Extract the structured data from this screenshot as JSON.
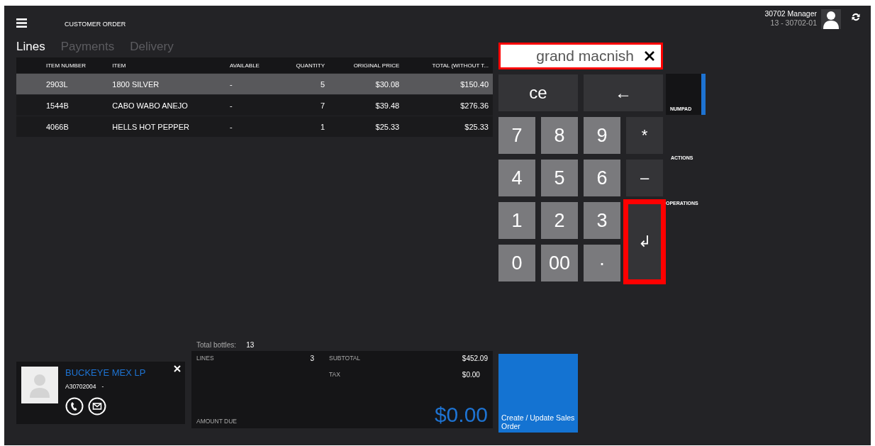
{
  "header": {
    "title": "CUSTOMER ORDER",
    "user_name": "30702 Manager",
    "user_terminal": "13 - 30702-01"
  },
  "tabs": [
    {
      "label": "Lines",
      "selected": true
    },
    {
      "label": "Payments",
      "selected": false
    },
    {
      "label": "Delivery",
      "selected": false
    }
  ],
  "table": {
    "columns": [
      "ITEM NUMBER",
      "ITEM",
      "AVAILABLE",
      "QUANTITY",
      "ORIGINAL PRICE",
      "TOTAL (WITHOUT T..."
    ],
    "rows": [
      {
        "cells": [
          "2903L",
          "1800 SILVER",
          "-",
          "5",
          "$30.08",
          "$150.40"
        ],
        "selected": true
      },
      {
        "cells": [
          "1544B",
          "CABO WABO ANEJO",
          "-",
          "7",
          "$39.48",
          "$276.36"
        ],
        "selected": false
      },
      {
        "cells": [
          "4066B",
          "HELLS HOT PEPPER",
          "-",
          "1",
          "$25.33",
          "$25.33"
        ],
        "selected": false
      }
    ]
  },
  "customer": {
    "name": "BUCKEYE MEX LP",
    "account": "A30702004",
    "extra": "-"
  },
  "totals": {
    "bottles_label": "Total bottles:",
    "bottles": "13",
    "lines_label": "LINES",
    "lines": "3",
    "subtotal_label": "SUBTOTAL",
    "subtotal": "$452.09",
    "tax_label": "TAX",
    "tax": "$0.00",
    "amount_due_label": "AMOUNT DUE",
    "amount_due": "$0.00"
  },
  "create_button": "Create / Update Sales Order",
  "search": {
    "value": "grand macnish",
    "highlighted": true
  },
  "keys": [
    {
      "label": "ce",
      "kind": "wide",
      "highlighted": false
    },
    {
      "label": "←",
      "kind": "wide",
      "highlighted": false
    },
    {
      "label": "7",
      "kind": "digit",
      "highlighted": false
    },
    {
      "label": "8",
      "kind": "digit",
      "highlighted": false
    },
    {
      "label": "9",
      "kind": "digit",
      "highlighted": false
    },
    {
      "label": "*",
      "kind": "op",
      "highlighted": false
    },
    {
      "label": "4",
      "kind": "digit",
      "highlighted": false
    },
    {
      "label": "5",
      "kind": "digit",
      "highlighted": false
    },
    {
      "label": "6",
      "kind": "digit",
      "highlighted": false
    },
    {
      "label": "–",
      "kind": "op",
      "highlighted": false
    },
    {
      "label": "1",
      "kind": "digit",
      "highlighted": false
    },
    {
      "label": "2",
      "kind": "digit",
      "highlighted": false
    },
    {
      "label": "3",
      "kind": "digit",
      "highlighted": false
    },
    {
      "label": "↲",
      "kind": "enter",
      "highlighted": true
    },
    {
      "label": "0",
      "kind": "digit",
      "highlighted": false
    },
    {
      "label": "00",
      "kind": "digit",
      "highlighted": false
    },
    {
      "label": "·",
      "kind": "digit",
      "highlighted": false
    }
  ],
  "side_tabs": [
    {
      "label": "NUMPAD",
      "selected": true
    },
    {
      "label": "ACTIONS",
      "selected": false
    },
    {
      "label": "OPERATIONS",
      "selected": false
    }
  ]
}
